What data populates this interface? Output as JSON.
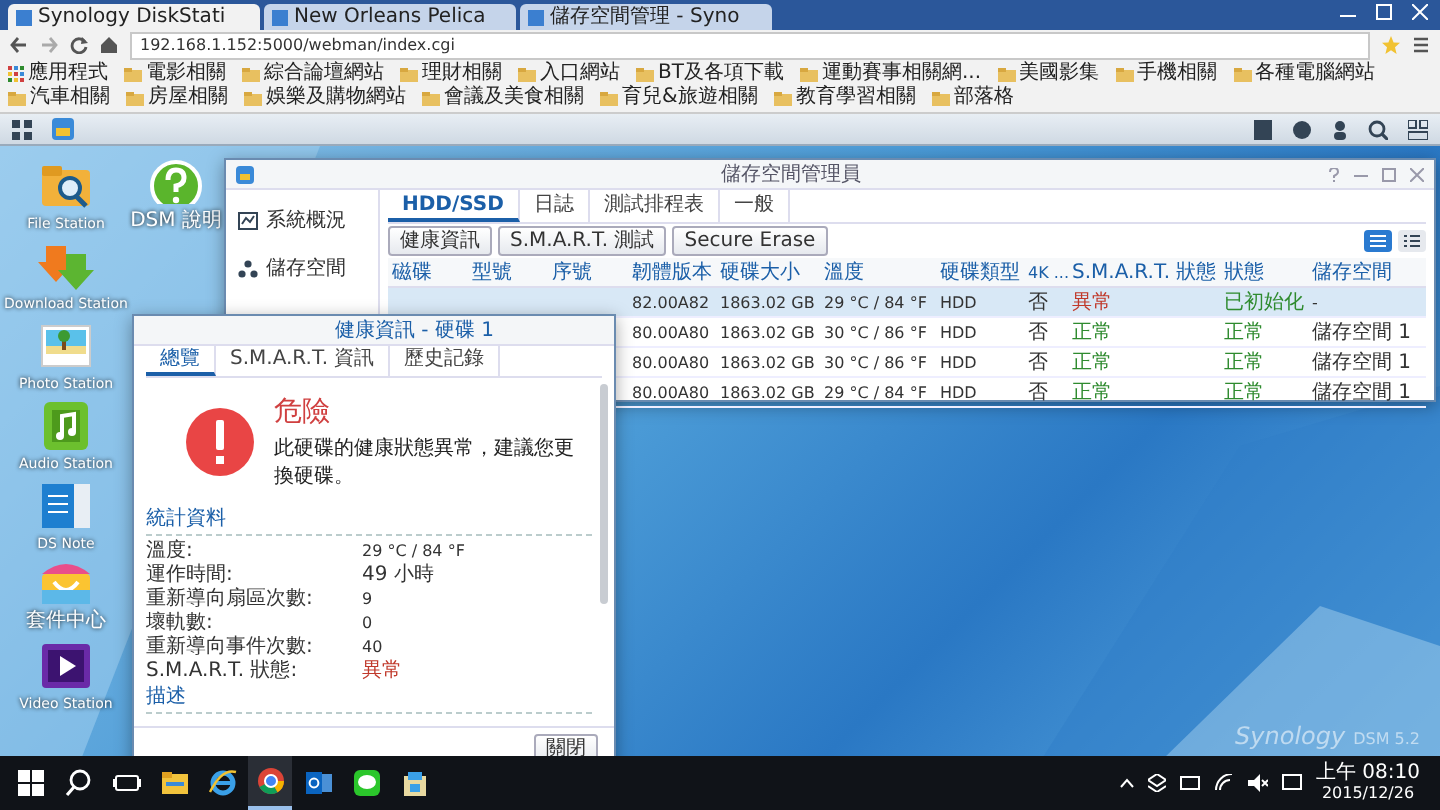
{
  "browser": {
    "tabs": [
      {
        "title": "Synology DiskStati",
        "selected": true
      },
      {
        "title": "New Orleans Pelica",
        "selected": false
      },
      {
        "title": "儲存空間管理 - Syno",
        "selected": false
      }
    ],
    "address": "192.168.1.152:5000/webman/index.cgi",
    "bookmarks": [
      {
        "label": "應用程式",
        "kind": "apps"
      },
      {
        "label": "電影相關",
        "kind": "folder"
      },
      {
        "label": "綜合論壇網站",
        "kind": "folder"
      },
      {
        "label": "理財相關",
        "kind": "folder"
      },
      {
        "label": "入口網站",
        "kind": "folder"
      },
      {
        "label": "BT及各項下載",
        "kind": "folder"
      },
      {
        "label": "運動賽事相關網...",
        "kind": "folder"
      },
      {
        "label": "美國影集",
        "kind": "folder"
      },
      {
        "label": "手機相關",
        "kind": "folder"
      },
      {
        "label": "各種電腦網站",
        "kind": "folder"
      },
      {
        "label": "汽車相關",
        "kind": "folder"
      },
      {
        "label": "房屋相關",
        "kind": "folder"
      },
      {
        "label": "娛樂及購物網站",
        "kind": "folder"
      },
      {
        "label": "會議及美食相關",
        "kind": "folder"
      },
      {
        "label": "育兒&旅遊相關",
        "kind": "folder"
      },
      {
        "label": "教育學習相關",
        "kind": "folder"
      },
      {
        "label": "部落格",
        "kind": "folder"
      }
    ]
  },
  "desktop": {
    "icons": [
      {
        "label": "File Station",
        "kind": "folder"
      },
      {
        "label": "Download Station",
        "kind": "download"
      },
      {
        "label": "Photo Station",
        "kind": "photo"
      },
      {
        "label": "Audio Station",
        "kind": "audio"
      },
      {
        "label": "DS Note",
        "kind": "note"
      },
      {
        "label": "套件中心",
        "kind": "package"
      },
      {
        "label": "Video Station",
        "kind": "video"
      },
      {
        "label": "DSM 說明",
        "kind": "help"
      }
    ],
    "brand": "Synology",
    "version": "DSM 5.2"
  },
  "storage_manager": {
    "title": "儲存空間管理員",
    "sidebar": [
      {
        "label": "系統概況",
        "kind": "overview",
        "selected": false
      },
      {
        "label": "儲存空間",
        "kind": "storage",
        "selected": false
      }
    ],
    "tabs": [
      {
        "label": "HDD/SSD",
        "selected": true
      },
      {
        "label": "日誌",
        "selected": false
      },
      {
        "label": "測試排程表",
        "selected": false
      },
      {
        "label": "一般",
        "selected": false
      }
    ],
    "buttons": [
      "健康資訊",
      "S.M.A.R.T. 測試",
      "Secure Erase"
    ],
    "views": [
      {
        "kind": "list",
        "selected": true
      },
      {
        "kind": "detail",
        "selected": false
      }
    ],
    "table": {
      "columns": [
        "磁碟",
        "型號",
        "序號",
        "韌體版本",
        "硬碟大小",
        "溫度",
        "硬碟類型",
        "4K ...",
        "S.M.A.R.T. 狀態",
        "狀態",
        "儲存空間"
      ],
      "rows": [
        {
          "selected": true,
          "alert": true,
          "cells": [
            "",
            "",
            "",
            "82.00A82",
            "1863.02 GB",
            "29 °C / 84 °F",
            "HDD",
            "否",
            "異常",
            "已初始化",
            "-"
          ]
        },
        {
          "selected": false,
          "alert": false,
          "cells": [
            "",
            "",
            "",
            "80.00A80",
            "1863.02 GB",
            "30 °C / 86 °F",
            "HDD",
            "否",
            "正常",
            "正常",
            "儲存空間 1"
          ]
        },
        {
          "selected": false,
          "alert": false,
          "cells": [
            "",
            "",
            "",
            "80.00A80",
            "1863.02 GB",
            "30 °C / 86 °F",
            "HDD",
            "否",
            "正常",
            "正常",
            "儲存空間 1"
          ]
        },
        {
          "selected": false,
          "alert": false,
          "cells": [
            "",
            "",
            "",
            "80.00A80",
            "1863.02 GB",
            "29 °C / 84 °F",
            "HDD",
            "否",
            "正常",
            "正常",
            "儲存空間 1"
          ]
        }
      ]
    }
  },
  "health_dialog": {
    "title": "健康資訊 - 硬碟 1",
    "tabs": [
      {
        "label": "總覽",
        "selected": true
      },
      {
        "label": "S.M.A.R.T. 資訊",
        "selected": false
      },
      {
        "label": "歷史記錄",
        "selected": false
      }
    ],
    "status": {
      "kind": "danger",
      "title": "危險",
      "message": "此硬碟的健康狀態異常，建議您更換硬碟。"
    },
    "statistics": {
      "heading": "統計資料",
      "rows": [
        {
          "label": "溫度:",
          "value": "29 °C / 84 °F",
          "alert": false
        },
        {
          "label": "運作時間:",
          "value": "49 小時",
          "alert": false
        },
        {
          "label": "重新導向扇區次數:",
          "value": "9",
          "alert": false
        },
        {
          "label": "壞軌數:",
          "value": "0",
          "alert": false
        },
        {
          "label": "重新導向事件次數:",
          "value": "40",
          "alert": false
        },
        {
          "label": "S.M.A.R.T. 狀態:",
          "value": "異常",
          "alert": true
        }
      ]
    },
    "description": {
      "heading": "描述"
    },
    "close_button": "關閉"
  },
  "taskbar": {
    "apps": [
      {
        "kind": "windows",
        "active": false
      },
      {
        "kind": "search",
        "active": false
      },
      {
        "kind": "taskview",
        "active": false
      },
      {
        "kind": "explorer",
        "active": false
      },
      {
        "kind": "ie",
        "active": false
      },
      {
        "kind": "chrome",
        "active": true
      },
      {
        "kind": "outlook",
        "active": false
      },
      {
        "kind": "line",
        "active": false
      },
      {
        "kind": "package",
        "active": false
      }
    ],
    "time": "上午 08:10",
    "date": "2015/12/26"
  }
}
